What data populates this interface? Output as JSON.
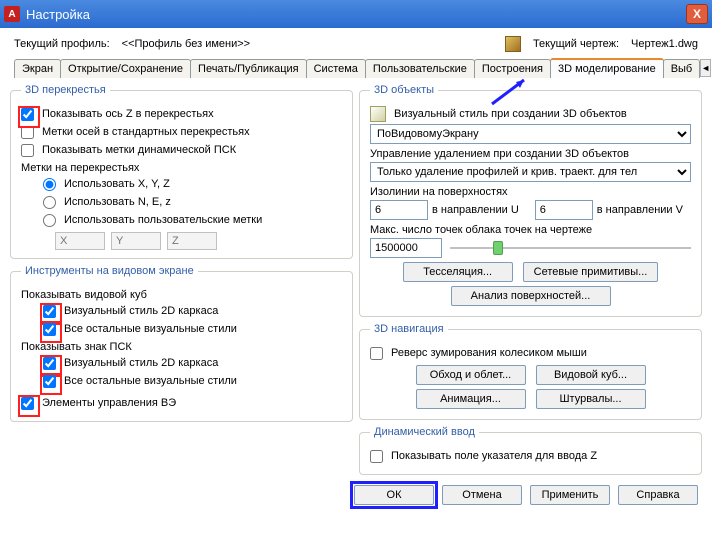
{
  "title": "Настройка",
  "close_x": "X",
  "header": {
    "current_profile_label": "Текущий профиль:",
    "current_profile_value": "<<Профиль без имени>>",
    "current_drawing_label": "Текущий чертеж:",
    "current_drawing_value": "Чертеж1.dwg"
  },
  "tabs": [
    "Экран",
    "Открытие/Сохранение",
    "Печать/Публикация",
    "Система",
    "Пользовательские",
    "Построения",
    "3D моделирование",
    "Выб"
  ],
  "left": {
    "crosshairs": {
      "legend": "3D перекрестья",
      "show_z": "Показывать ось Z в перекрестьях",
      "axis_labels": "Метки осей в стандартных перекрестьях",
      "dyn_ucs": "Показывать метки динамической ПСК",
      "labels_on": "Метки на перекрестьях",
      "use_xyz": "Использовать X, Y, Z",
      "use_nez": "Использовать N, E, z",
      "use_custom": "Использовать пользовательские метки",
      "x_ph": "X",
      "y_ph": "Y",
      "z_ph": "Z"
    },
    "viewport_tools": {
      "legend": "Инструменты на видовом экране",
      "show_cube": "Показывать видовой куб",
      "vs_2d": "Визуальный стиль 2D каркаса",
      "vs_all": "Все остальные визуальные стили",
      "show_ucs": "Показывать знак ПСК",
      "ve_controls": "Элементы управления ВЭ"
    }
  },
  "right": {
    "objects": {
      "legend": "3D объекты",
      "visual_style_label": "Визуальный стиль при создании 3D объектов",
      "visual_style_value": "ПоВидовомуЭкрану",
      "delete_ctrl_label": "Управление удалением при создании 3D объектов",
      "delete_ctrl_value": "Только удаление профилей и крив. траект. для тел",
      "isolines_label": "Изолинии на поверхностях",
      "iso_u": "6",
      "dir_u": "в направлении U",
      "iso_v": "6",
      "dir_v": "в направлении V",
      "max_cloud": "Макс. число точек облака точек на чертеже",
      "max_cloud_val": "1500000",
      "btn_tess": "Тесселяция...",
      "btn_mesh": "Сетевые примитивы...",
      "btn_surface": "Анализ поверхностей..."
    },
    "navigation": {
      "legend": "3D навигация",
      "reverse_zoom": "Реверс зумирования колесиком мыши",
      "btn_walk": "Обход и облет...",
      "btn_cube": "Видовой куб...",
      "btn_anim": "Анимация...",
      "btn_wheel": "Штурвалы..."
    },
    "dynamic": {
      "legend": "Динамический ввод",
      "show_z_field": "Показывать поле указателя для ввода Z"
    }
  },
  "footer": {
    "ok": "ОК",
    "cancel": "Отмена",
    "apply": "Применить",
    "help": "Справка"
  },
  "icon_A": "А"
}
